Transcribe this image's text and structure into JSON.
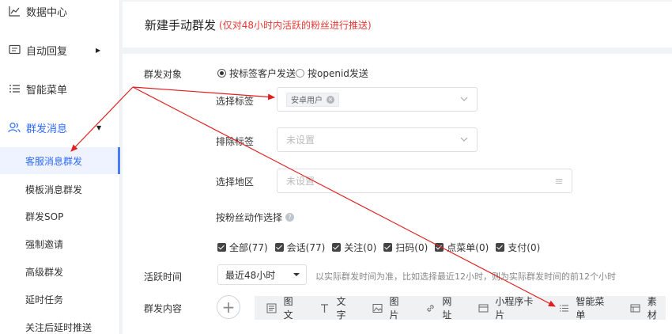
{
  "sidebar": {
    "items": [
      {
        "label": "数据中心",
        "icon": "chart-line-icon"
      },
      {
        "label": "自动回复",
        "icon": "message-icon"
      },
      {
        "label": "智能菜单",
        "icon": "menu-list-icon"
      },
      {
        "label": "群发消息",
        "icon": "users-icon"
      }
    ],
    "sub_items": [
      {
        "label": "客服消息群发"
      },
      {
        "label": "模板消息群发"
      },
      {
        "label": "群发SOP"
      },
      {
        "label": "强制邀请"
      },
      {
        "label": "高级群发"
      },
      {
        "label": "延时任务"
      },
      {
        "label": "关注后延时推送"
      }
    ]
  },
  "header": {
    "title": "新建手动群发",
    "note": "(仅对48小时内活跃的粉丝进行推送)"
  },
  "form": {
    "target_label": "群发对象",
    "radio_tag": "按标签客户发送",
    "radio_openid": "按openid发送",
    "select_tag_label": "选择标签",
    "selected_tag": "安卓用户",
    "exclude_tag_label": "排除标签",
    "exclude_placeholder": "未设置",
    "region_label": "选择地区",
    "region_placeholder": "未设置",
    "action_label": "按粉丝动作选择",
    "help_glyph": "?",
    "checkboxes": [
      {
        "label": "全部(77)"
      },
      {
        "label": "会话(77)"
      },
      {
        "label": "关注(0)"
      },
      {
        "label": "扫码(0)"
      },
      {
        "label": "点菜单(0)"
      },
      {
        "label": "支付(0)"
      }
    ],
    "active_time_label": "活跃时间",
    "active_time_value": "最近48小时",
    "active_time_hint": "以实际群发时间为准，比如选择最近12小时，则为实际群发时间的前12个小时",
    "content_label": "群发内容",
    "plus_glyph": "+",
    "tools": [
      {
        "label": "图文",
        "icon": "article-icon"
      },
      {
        "label": "文字",
        "icon": "text-icon"
      },
      {
        "label": "图片",
        "icon": "image-icon"
      },
      {
        "label": "网址",
        "icon": "link-icon"
      },
      {
        "label": "小程序卡片",
        "icon": "miniprogram-card-icon"
      },
      {
        "label": "智能菜单",
        "icon": "smart-menu-icon"
      },
      {
        "label": "素材",
        "icon": "material-icon"
      }
    ]
  },
  "colors": {
    "accent": "#2f6bff",
    "note_red": "#e53935",
    "arrow_red": "#e02020"
  }
}
